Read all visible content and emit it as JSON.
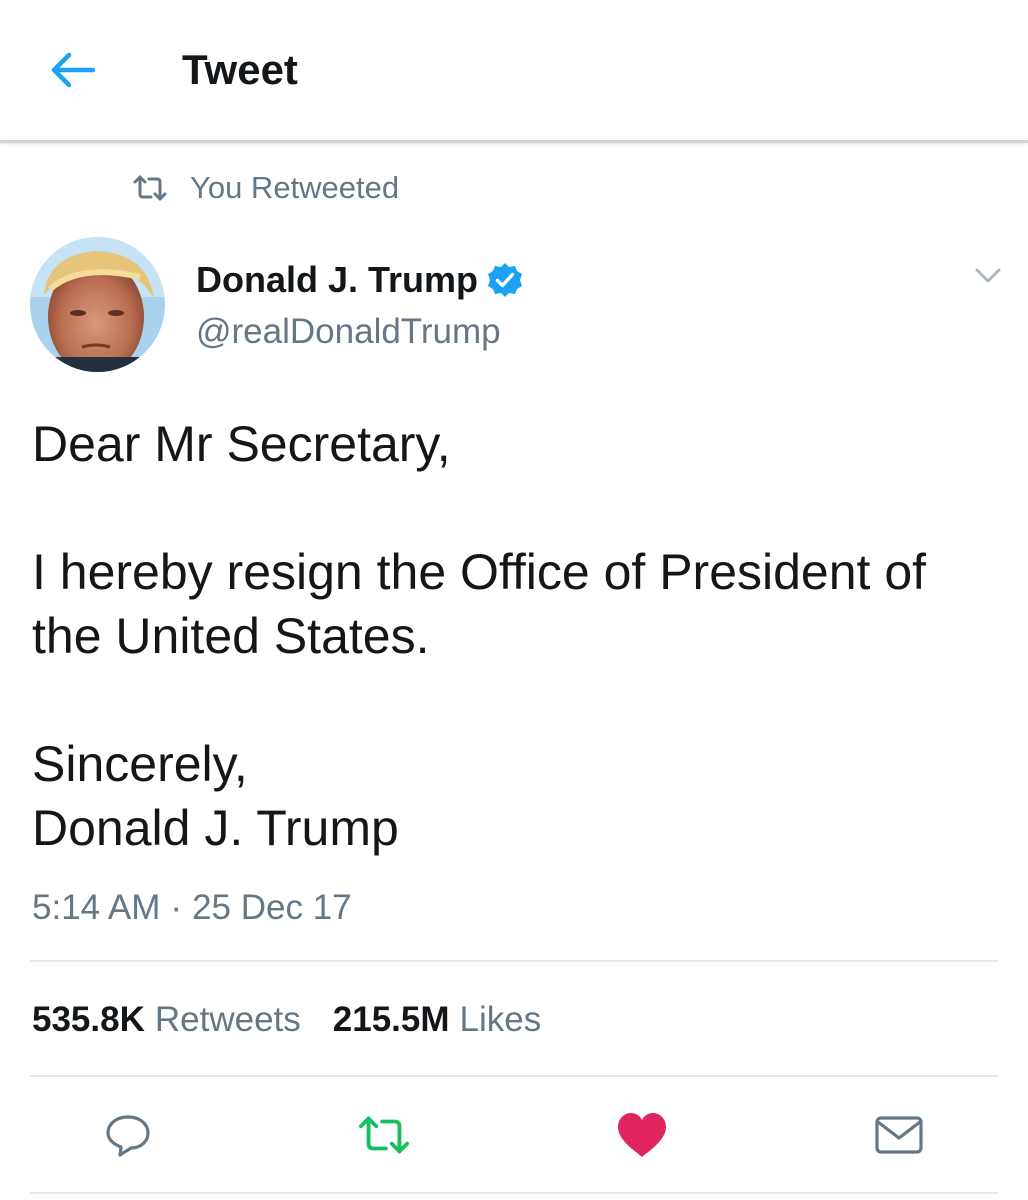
{
  "header": {
    "title": "Tweet",
    "back_icon": "arrow-left-icon"
  },
  "colors": {
    "accent": "#1da1f2",
    "text_primary": "#14171a",
    "text_secondary": "#657786",
    "retweet_active": "#17bf63",
    "like_active": "#e0245e",
    "divider": "#e1e8ed"
  },
  "social_context": {
    "icon": "retweet-icon",
    "text": "You Retweeted"
  },
  "author": {
    "display_name": "Donald J. Trump",
    "handle": "@realDonaldTrump",
    "verified": true,
    "verified_icon": "verified-badge-icon"
  },
  "tweet": {
    "paragraphs": [
      "Dear Mr Secretary,",
      "I hereby resign the Office of President of the United States.",
      [
        "Sincerely,",
        "Donald J. Trump"
      ]
    ],
    "time": "5:14 AM",
    "separator": "·",
    "date": "25 Dec 17"
  },
  "stats": {
    "retweets_count": "535.8K",
    "retweets_label": "Retweets",
    "likes_count": "215.5M",
    "likes_label": "Likes"
  },
  "actions": {
    "reply_icon": "reply-icon",
    "retweet_icon": "retweet-icon",
    "retweeted": true,
    "like_icon": "heart-icon",
    "liked": true,
    "share_icon": "envelope-icon"
  }
}
